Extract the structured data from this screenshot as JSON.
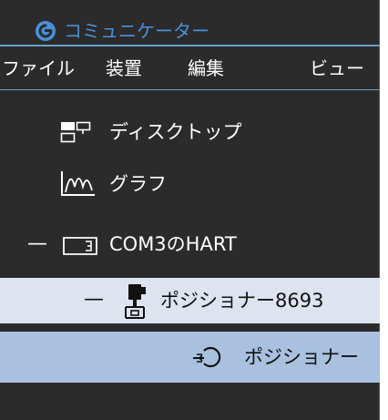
{
  "app": {
    "title": "コミュニケーター",
    "title_icon": "power-ring-icon",
    "accent_color": "#4a90d9"
  },
  "menu": [
    {
      "label": "ファイル"
    },
    {
      "label": "装置"
    },
    {
      "label": "編集"
    },
    {
      "label": "ビュー"
    }
  ],
  "tree": {
    "desktop": {
      "label": "ディスクトップ",
      "icon": "desktop-windows-icon"
    },
    "graph": {
      "label": "グラフ",
      "icon": "graph-icon"
    },
    "com": {
      "label": "COM3のHART",
      "icon": "serial-port-icon",
      "expander": "—"
    },
    "device": {
      "label": "ポジショナー8693",
      "icon": "positioner-device-icon",
      "expander": "—",
      "highlight": "#dde3ef"
    },
    "function": {
      "label": "ポジショナー",
      "icon": "positioner-function-icon",
      "highlight": "#a9c0df"
    }
  }
}
